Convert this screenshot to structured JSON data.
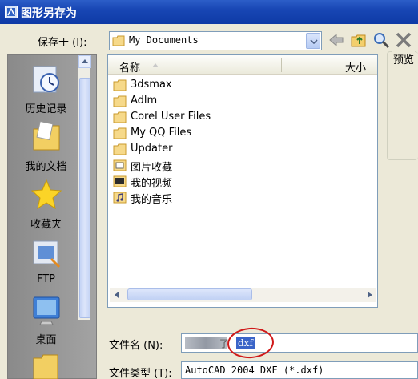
{
  "window": {
    "title": "图形另存为"
  },
  "save_in": {
    "label": "保存于 (I):",
    "value": "My Documents"
  },
  "places": [
    {
      "label": "历史记录"
    },
    {
      "label": "我的文档"
    },
    {
      "label": "收藏夹"
    },
    {
      "label": "FTP"
    },
    {
      "label": "桌面"
    }
  ],
  "columns": {
    "name": "名称",
    "size": "大小"
  },
  "files": [
    {
      "name": "3dsmax",
      "icon": "folder-icon"
    },
    {
      "name": "Adlm",
      "icon": "folder-icon"
    },
    {
      "name": "Corel User Files",
      "icon": "folder-icon"
    },
    {
      "name": "My QQ Files",
      "icon": "folder-icon"
    },
    {
      "name": "Updater",
      "icon": "folder-icon"
    },
    {
      "name": "图片收藏",
      "icon": "pictures-folder-icon"
    },
    {
      "name": "我的视频",
      "icon": "video-folder-icon"
    },
    {
      "name": "我的音乐",
      "icon": "music-folder-icon"
    }
  ],
  "preview": {
    "label": "预览"
  },
  "filename": {
    "label": "文件名 (N):",
    "prefix": "了",
    "value": "dxf"
  },
  "filetype": {
    "label": "文件类型 (T):",
    "value": "AutoCAD 2004 DXF (*.dxf)"
  },
  "colors": {
    "titlebar": "#1846b4",
    "annotation_circle": "#d01818",
    "selection": "#3a64c8"
  }
}
